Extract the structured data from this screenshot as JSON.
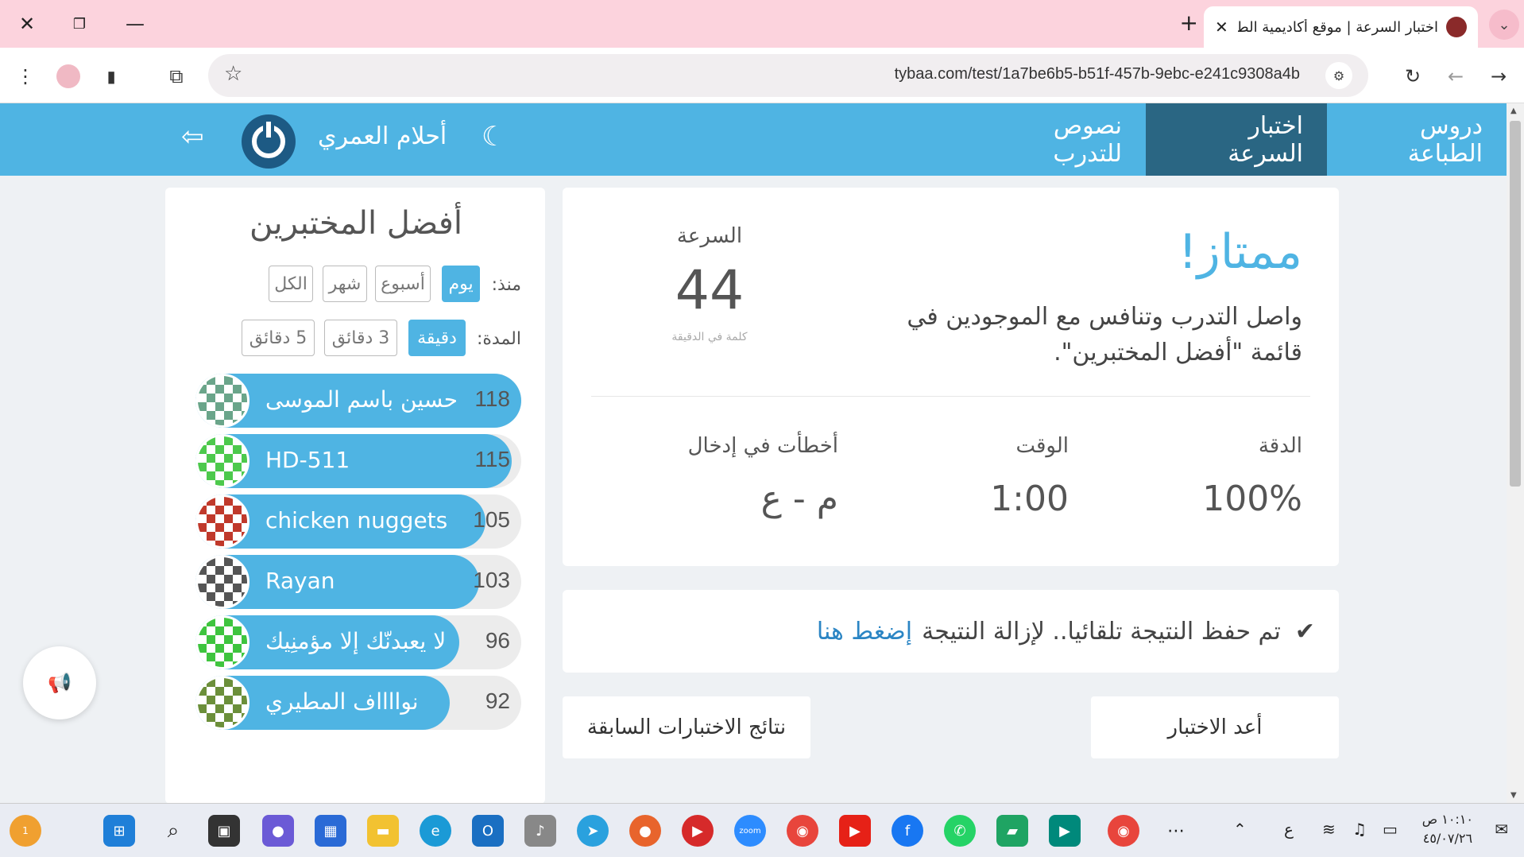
{
  "browser": {
    "tab_title": "اختبار السرعة | موقع أكاديمية الط",
    "url": "tybaa.com/test/1a7be6b5-b51f-457b-9ebc-e241c9308a4b",
    "close_glyph": "✕",
    "new_tab_glyph": "+",
    "menu_glyph": "⌄"
  },
  "nav": {
    "items": [
      "دروس الطباعة",
      "اختبار السرعة",
      "نصوص للتدرب"
    ],
    "user_name": "أحلام العمري",
    "moon_glyph": "☾",
    "logout_glyph": "⇦"
  },
  "result": {
    "headline": "ممتاز!",
    "message": "واصل التدرب وتنافس مع الموجودين في قائمة \"أفضل المختبرين\".",
    "speed_label": "السرعة",
    "speed_value": "44",
    "speed_unit": "كلمة في الدقيقة",
    "accuracy_label": "الدقة",
    "accuracy_value": "100%",
    "time_label": "الوقت",
    "time_value": "1:00",
    "errors_label": "أخطأت في إدخال",
    "errors_value": "م - ع"
  },
  "saved": {
    "text": "تم حفظ النتيجة تلقائيا.. لإزالة النتيجة",
    "link": "إضغط هنا",
    "check_glyph": "✔"
  },
  "buttons": {
    "retry": "أعد الاختبار",
    "history": "نتائج الاختبارات السابقة"
  },
  "leaderboard": {
    "title": "أفضل المختبرين",
    "since_label": "منذ:",
    "since_options": [
      "يوم",
      "أسبوع",
      "شهر",
      "الكل"
    ],
    "since_selected": 0,
    "duration_label": "المدة:",
    "duration_options": [
      "دقيقة",
      "3 دقائق",
      "5 دقائق"
    ],
    "duration_selected": 0,
    "entries": [
      {
        "name": "حسين باسم الموسى",
        "score": "118",
        "fill": 1.0,
        "avatar_color": "#6aa58a"
      },
      {
        "name": "HD-511",
        "score": "115",
        "fill": 0.97,
        "avatar_color": "#4cc94c"
      },
      {
        "name": "chicken nuggets",
        "score": "105",
        "fill": 0.89,
        "avatar_color": "#c0392b"
      },
      {
        "name": "Rayan",
        "score": "103",
        "fill": 0.87,
        "avatar_color": "#555555"
      },
      {
        "name": "لا يعبدنّك إلا مؤمنِيك",
        "score": "96",
        "fill": 0.81,
        "avatar_color": "#3ec43e"
      },
      {
        "name": "نوااااف المطيري",
        "score": "92",
        "fill": 0.78,
        "avatar_color": "#6b8f3a"
      }
    ]
  },
  "megaphone_glyph": "📢",
  "taskbar": {
    "time": "١٠:١٠ ص",
    "date": "٤٥/٠٧/٢٦",
    "lang": "ع",
    "badge": "1"
  },
  "colors": {
    "accent": "#4fb4e3",
    "nav_active": "#2a6683",
    "link": "#2b85c4"
  }
}
